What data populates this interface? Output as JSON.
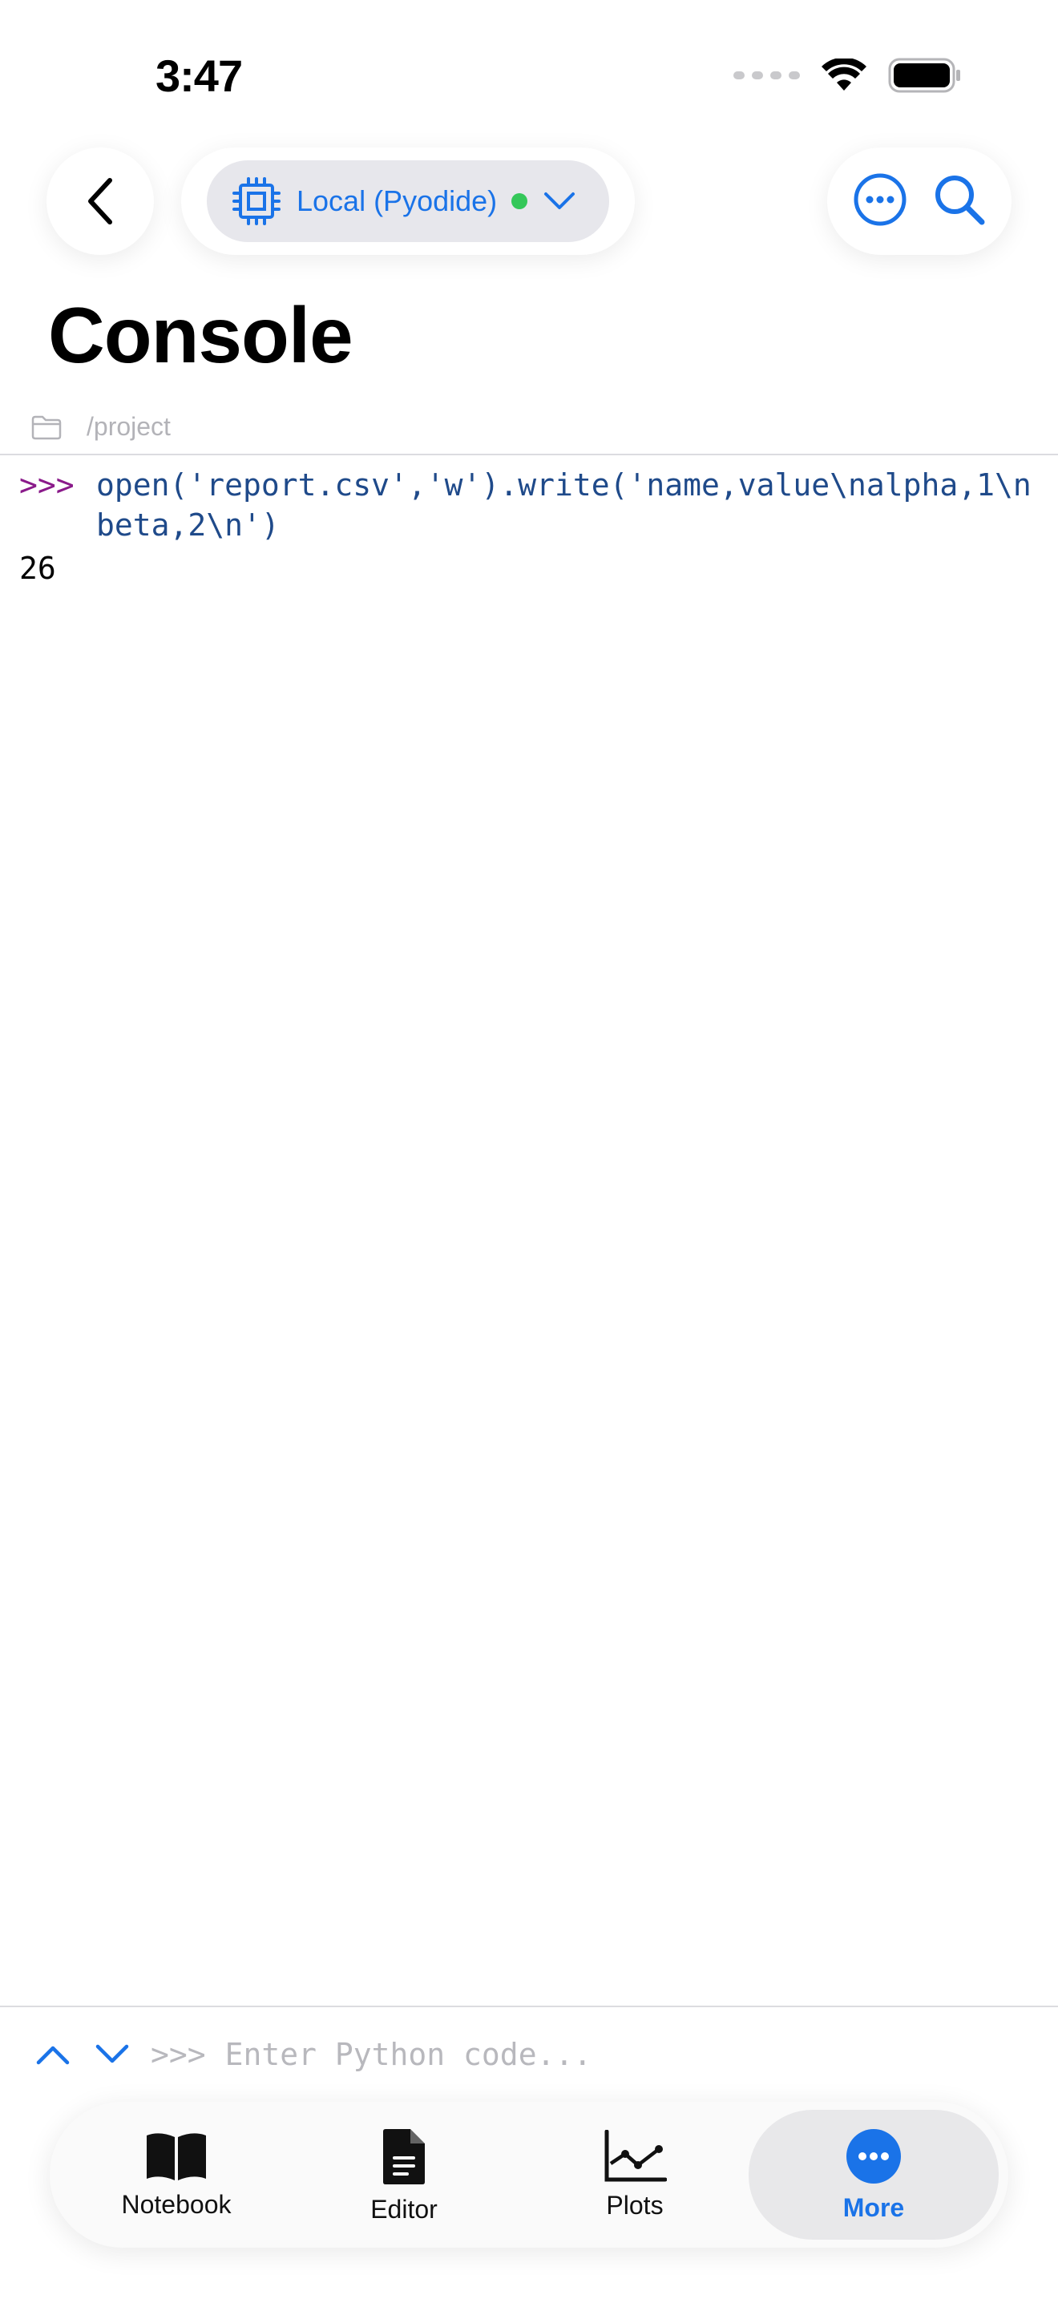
{
  "status_bar": {
    "time": "3:47"
  },
  "header": {
    "environment_label": "Local (Pyodide)",
    "title": "Console",
    "path": "/project"
  },
  "console": {
    "entries": [
      {
        "prompt": ">>>",
        "code": "open('report.csv','w').write('name,value\\nalpha,1\\nbeta,2\\n')",
        "result": "26"
      }
    ]
  },
  "input": {
    "prompt": ">>>",
    "placeholder": "Enter Python code..."
  },
  "tabs": [
    {
      "label": "Notebook",
      "icon": "book-icon",
      "active": false
    },
    {
      "label": "Editor",
      "icon": "document-icon",
      "active": false
    },
    {
      "label": "Plots",
      "icon": "chart-icon",
      "active": false
    },
    {
      "label": "More",
      "icon": "more-icon",
      "active": true
    }
  ],
  "colors": {
    "accent": "#1a73e8",
    "status_ok": "#34c759",
    "prompt": "#8a1a8a",
    "code": "#1f4a8a"
  }
}
